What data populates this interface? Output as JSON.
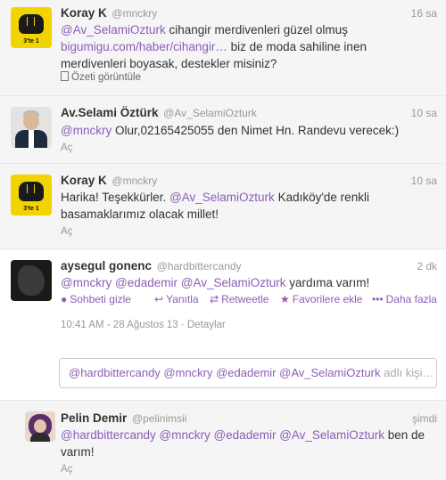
{
  "tweets": [
    {
      "name": "Koray K",
      "handle": "@mnckry",
      "time": "16 sa",
      "avatar_tag": "3'te 1",
      "mention": "@Av_SelamiOzturk",
      "text1": " cihangir merdivenleri güzel olmuş",
      "link": "bigumigu.com/haber/cihangir…",
      "text2": " biz de moda sahiline inen",
      "text3": "merdivenleri boyasak, destekler misiniz?",
      "summary": "Özeti görüntüle"
    },
    {
      "name": "Av.Selami Öztürk",
      "handle": "@Av_SelamiOzturk",
      "time": "10 sa",
      "mention": "@mnckry",
      "text1": " Olur,02165425055 den Nimet  Hn. Randevu verecek:)",
      "reply": "Aç"
    },
    {
      "name": "Koray K",
      "handle": "@mnckry",
      "time": "10 sa",
      "avatar_tag": "3'te 1",
      "text0": "Harika! Teşekkürler. ",
      "mention": "@Av_SelamiOzturk",
      "text1": " Kadıköy'de renkli",
      "text2": "basamaklarımız olacak millet!",
      "reply": "Aç"
    },
    {
      "name": "aysegul gonenc",
      "handle": "@hardbittercandy",
      "time": "2 dk",
      "mention1": "@mnckry",
      "mention2": "@edademir",
      "mention3": "@Av_SelamiOzturk",
      "text1": " yardıma varım!",
      "actions": {
        "hide": "Sohbeti gizle",
        "reply": "Yanıtla",
        "retweet": "Retweetle",
        "favorite": "Favorilere ekle",
        "more": "Daha fazla"
      },
      "meta": "10:41 AM - 28 Ağustos 13 · Detaylar",
      "reply_box": "@hardbittercandy @mnckry @edademir @Av_SelamiOzturk",
      "reply_placeholder": " adlı kişi…"
    },
    {
      "name": "Pelin Demir",
      "handle": "@pelinimsii",
      "time": "şimdi",
      "mentions": "@hardbittercandy @mnckry @edademir @Av_SelamiOzturk",
      "text1": " ben de",
      "text2": "varım!",
      "reply": "Aç"
    }
  ],
  "colors": {
    "link": "#8c5db8",
    "muted": "#999999"
  }
}
